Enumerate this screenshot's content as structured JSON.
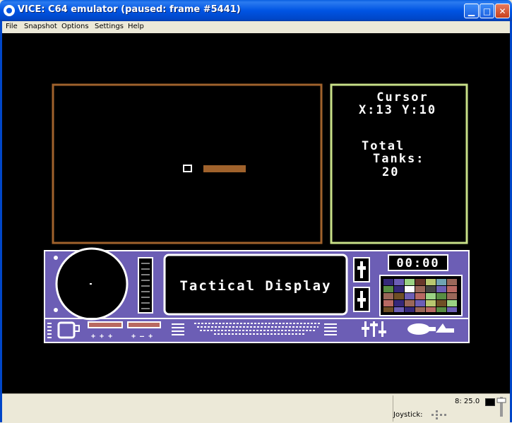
{
  "window": {
    "title": "VICE: C64 emulator (paused: frame #5441)",
    "buttons": {
      "minimize": "▁",
      "maximize": "□",
      "close": "✕"
    }
  },
  "menu": [
    "File",
    "Snapshot",
    "Options",
    "Settings",
    "Help"
  ],
  "game": {
    "cursor_title": "Cursor",
    "cursor_coords": "X:13 Y:10",
    "total_label": "Total",
    "tanks_label": "Tanks:",
    "tanks_count": "20",
    "display_label": "Tactical Display",
    "timer": "00:00"
  },
  "status": {
    "speed": "8: 25.0",
    "joystick_label": "Joystick:"
  },
  "colors": {
    "titlebar": "#0054E3",
    "map_border": "#A0622C",
    "info_border": "#C8E088",
    "panel": "#6C5EB5",
    "screen_bg": "#000000",
    "tank": "#A0622C"
  }
}
